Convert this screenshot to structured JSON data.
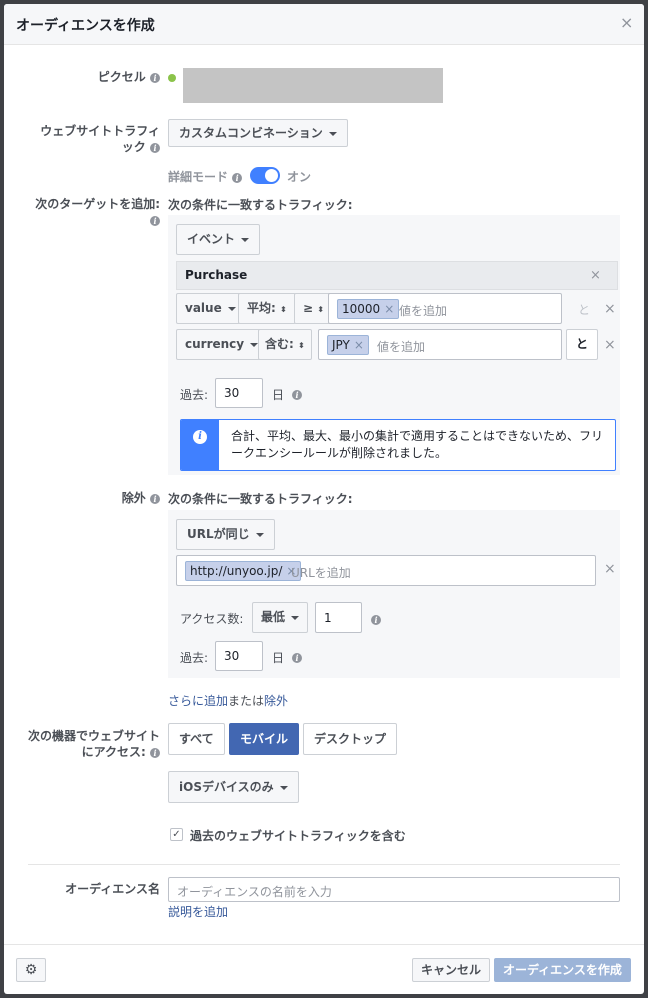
{
  "dialog": {
    "title": "オーディエンスを作成",
    "close": "×"
  },
  "pixel": {
    "label": "ピクセル",
    "status_color": "#8bc34a"
  },
  "traffic": {
    "label_line1": "ウェブサイトトラフィ",
    "label_line2": "ック",
    "value": "カスタムコンビネーション"
  },
  "detail_mode": {
    "label": "詳細モード",
    "toggle_text": "オン",
    "on": true
  },
  "include": {
    "label": "次のターゲットを追加:",
    "condition": "次の条件に一致するトラフィック:",
    "type": "イベント",
    "event_name": "Purchase",
    "rule1": {
      "param": "value",
      "agg": "平均:",
      "op": "≥",
      "token": "10000",
      "placeholder": "値を追加",
      "and": "と"
    },
    "rule2": {
      "param": "currency",
      "op": "含む:",
      "token": "JPY",
      "placeholder": "値を追加",
      "and": "と"
    },
    "past_label": "過去:",
    "past_value": "30",
    "past_unit": "日",
    "notice": "合計、平均、最大、最小の集計で適用することはできないため、フリークエンシールールが削除されました。"
  },
  "exclude": {
    "label": "除外",
    "condition": "次の条件に一致するトラフィック:",
    "type": "URLが同じ",
    "token": "http://unyoo.jp/",
    "placeholder": "URLを追加",
    "access_label": "アクセス数:",
    "access_op": "最低",
    "access_value": "1",
    "past_label": "過去:",
    "past_value": "30",
    "past_unit": "日"
  },
  "more": {
    "add": "さらに追加",
    "or": "または",
    "exclude": "除外"
  },
  "device": {
    "label_line1": "次の機器でウェブサイト",
    "label_line2": "にアクセス:",
    "options": [
      "すべて",
      "モバイル",
      "デスクトップ"
    ],
    "selected": "モバイル",
    "sub": "iOSデバイスのみ"
  },
  "past_traffic": {
    "label": "過去のウェブサイトトラフィックを含む",
    "checked": true
  },
  "audience_name": {
    "label": "オーディエンス名",
    "placeholder": "オーディエンスの名前を入力",
    "add_desc": "説明を追加"
  },
  "footer": {
    "cancel": "キャンセル",
    "create": "オーディエンスを作成"
  }
}
